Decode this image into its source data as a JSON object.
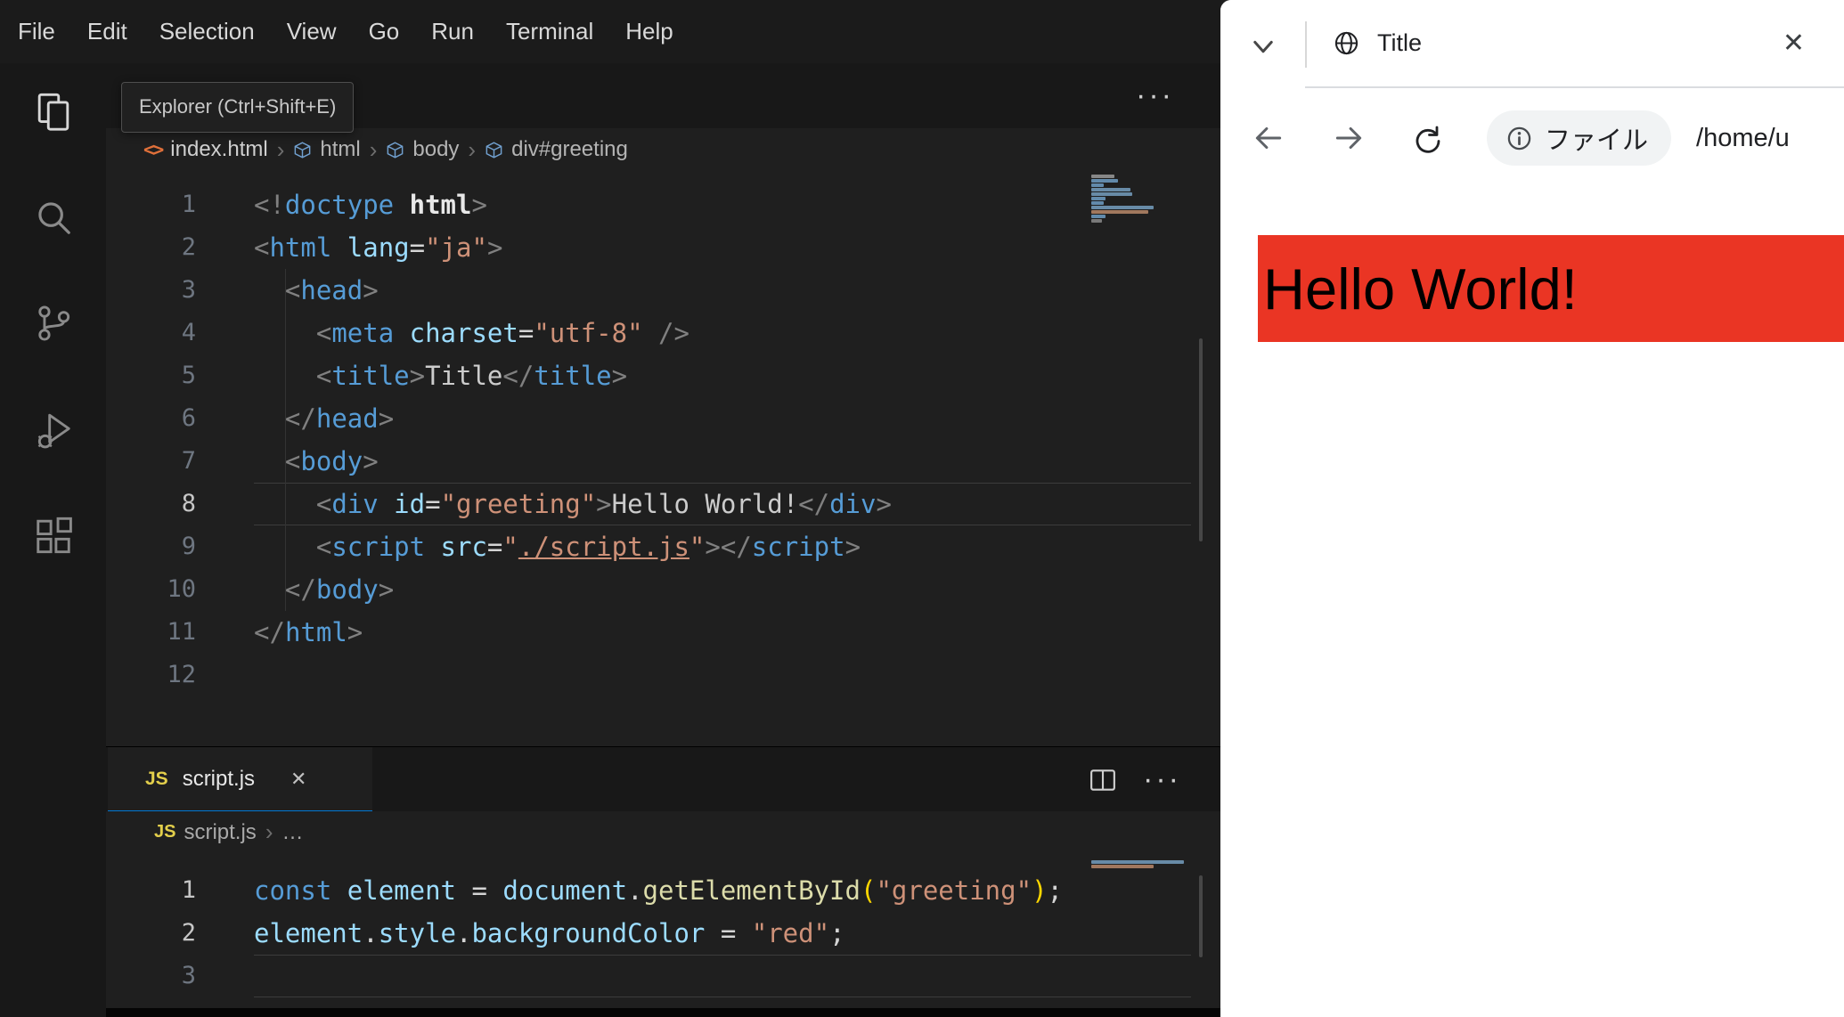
{
  "colors": {
    "accent_blue": "#0078d4",
    "red_heading_bg": "#ea3524",
    "editor_background": "#1f1f1f",
    "side_background": "#181818",
    "tag_blue": "#569cd6",
    "attribute_lightblue": "#9cdcfe",
    "string_orange": "#ce9178",
    "function_yellow": "#dcdcaa",
    "js_icon_yellow": "#e3cf4b"
  },
  "vscode": {
    "menubar": [
      "File",
      "Edit",
      "Selection",
      "View",
      "Go",
      "Run",
      "Terminal",
      "Help"
    ],
    "tooltip": "Explorer (Ctrl+Shift+E)",
    "editor_actions_label": "···",
    "breadcrumb_separator": "›",
    "activity_icons": [
      "files-icon",
      "search-icon",
      "source-control-icon",
      "run-debug-icon",
      "extensions-icon"
    ],
    "breadcrumbs_top": [
      {
        "icon": "code",
        "label": "index.html"
      },
      {
        "icon": "cube",
        "label": "html"
      },
      {
        "icon": "cube",
        "label": "body"
      },
      {
        "icon": "cube",
        "label": "div#greeting"
      }
    ],
    "html_editor": {
      "active_line": 8,
      "lines": [
        [
          [
            "p",
            "<!"
          ],
          [
            "t",
            "doctype"
          ],
          [
            "w",
            " "
          ],
          [
            "h",
            "html"
          ],
          [
            "p",
            ">"
          ]
        ],
        [
          [
            "p",
            "<"
          ],
          [
            "t",
            "html"
          ],
          [
            "a",
            " lang"
          ],
          [
            "o",
            "="
          ],
          [
            "s",
            "\"ja\""
          ],
          [
            "p",
            ">"
          ]
        ],
        [
          [
            "w",
            "  "
          ],
          [
            "p",
            "<"
          ],
          [
            "t",
            "head"
          ],
          [
            "p",
            ">"
          ]
        ],
        [
          [
            "w",
            "    "
          ],
          [
            "p",
            "<"
          ],
          [
            "t",
            "meta"
          ],
          [
            "a",
            " charset"
          ],
          [
            "o",
            "="
          ],
          [
            "s",
            "\"utf-8\""
          ],
          [
            "w",
            " "
          ],
          [
            "p",
            "/>"
          ]
        ],
        [
          [
            "w",
            "    "
          ],
          [
            "p",
            "<"
          ],
          [
            "t",
            "title"
          ],
          [
            "p",
            ">"
          ],
          [
            "w",
            "Title"
          ],
          [
            "p",
            "<"
          ],
          [
            "p",
            "/"
          ],
          [
            "t",
            "title"
          ],
          [
            "p",
            ">"
          ]
        ],
        [
          [
            "w",
            "  "
          ],
          [
            "p",
            "<"
          ],
          [
            "p",
            "/"
          ],
          [
            "t",
            "head"
          ],
          [
            "p",
            ">"
          ]
        ],
        [
          [
            "w",
            "  "
          ],
          [
            "p",
            "<"
          ],
          [
            "t",
            "body"
          ],
          [
            "p",
            ">"
          ]
        ],
        [
          [
            "w",
            "    "
          ],
          [
            "p",
            "<"
          ],
          [
            "t",
            "div"
          ],
          [
            "a",
            " id"
          ],
          [
            "o",
            "="
          ],
          [
            "s",
            "\"greeting\""
          ],
          [
            "p",
            ">"
          ],
          [
            "w",
            "Hello World!"
          ],
          [
            "p",
            "<"
          ],
          [
            "p",
            "/"
          ],
          [
            "t",
            "div"
          ],
          [
            "p",
            ">"
          ]
        ],
        [
          [
            "w",
            "    "
          ],
          [
            "p",
            "<"
          ],
          [
            "t",
            "script"
          ],
          [
            "a",
            " src"
          ],
          [
            "o",
            "="
          ],
          [
            "s",
            "\""
          ],
          [
            "u",
            "./script.js"
          ],
          [
            "s",
            "\""
          ],
          [
            "p",
            ">"
          ],
          [
            "p",
            "<"
          ],
          [
            "p",
            "/"
          ],
          [
            "t",
            "script"
          ],
          [
            "p",
            ">"
          ]
        ],
        [
          [
            "w",
            "  "
          ],
          [
            "p",
            "<"
          ],
          [
            "p",
            "/"
          ],
          [
            "t",
            "body"
          ],
          [
            "p",
            ">"
          ]
        ],
        [
          [
            "p",
            "<"
          ],
          [
            "p",
            "/"
          ],
          [
            "t",
            "html"
          ],
          [
            "p",
            ">"
          ]
        ],
        []
      ]
    },
    "bottom_tab": {
      "icon_label": "JS",
      "label": "script.js",
      "close": "✕"
    },
    "breadcrumbs_bottom": [
      {
        "icon": "js",
        "label": "script.js"
      },
      {
        "icon": "none",
        "label": "…"
      }
    ],
    "js_editor": {
      "active_line": 3,
      "bright_lines": [
        1,
        2
      ],
      "lines": [
        [
          [
            "k",
            "const"
          ],
          [
            "w",
            " "
          ],
          [
            "a",
            "element"
          ],
          [
            "o",
            " = "
          ],
          [
            "a",
            "document"
          ],
          [
            "o",
            "."
          ],
          [
            "f",
            "getElementById"
          ],
          [
            "b",
            "("
          ],
          [
            "s",
            "\"greeting\""
          ],
          [
            "b",
            ")"
          ],
          [
            "o",
            ";"
          ]
        ],
        [
          [
            "a",
            "element"
          ],
          [
            "o",
            "."
          ],
          [
            "a",
            "style"
          ],
          [
            "o",
            "."
          ],
          [
            "a",
            "backgroundColor"
          ],
          [
            "o",
            " = "
          ],
          [
            "s",
            "\"red\""
          ],
          [
            "o",
            ";"
          ]
        ],
        []
      ]
    }
  },
  "browser": {
    "tab_title": "Title",
    "tab_close": "✕",
    "url_chip": "ファイル",
    "url_text": "/home/u",
    "page_heading": "Hello World!",
    "icons": [
      "tab-search-chevron-icon",
      "globe-icon",
      "back-icon",
      "forward-icon",
      "reload-icon",
      "info-icon",
      "close-icon"
    ]
  }
}
